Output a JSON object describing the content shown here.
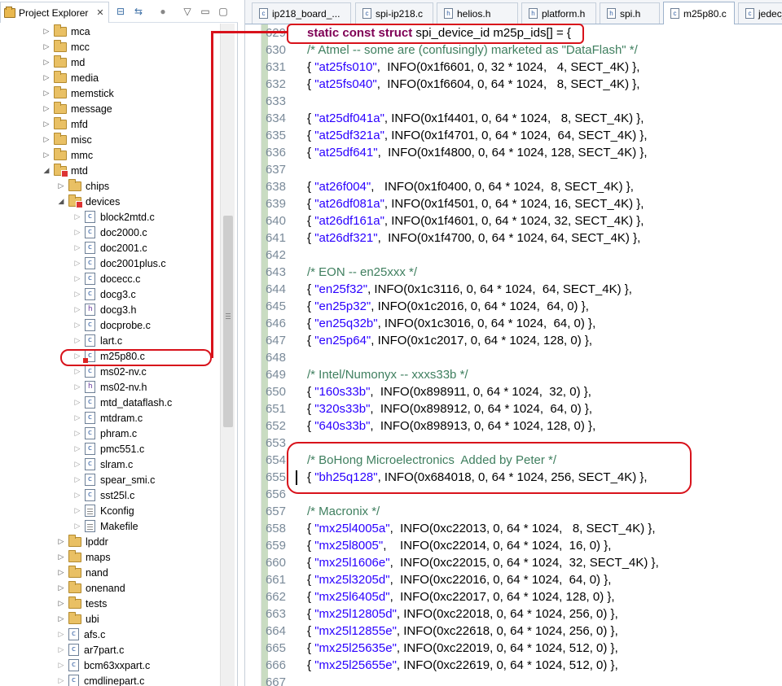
{
  "project_explorer": {
    "tab_label": "Project Explorer",
    "tree": [
      {
        "label": "mca",
        "type": "folder",
        "depth": 0,
        "expanded": false
      },
      {
        "label": "mcc",
        "type": "folder",
        "depth": 0,
        "expanded": false
      },
      {
        "label": "md",
        "type": "folder",
        "depth": 0,
        "expanded": false
      },
      {
        "label": "media",
        "type": "folder",
        "depth": 0,
        "expanded": false
      },
      {
        "label": "memstick",
        "type": "folder",
        "depth": 0,
        "expanded": false
      },
      {
        "label": "message",
        "type": "folder",
        "depth": 0,
        "expanded": false
      },
      {
        "label": "mfd",
        "type": "folder",
        "depth": 0,
        "expanded": false
      },
      {
        "label": "misc",
        "type": "folder",
        "depth": 0,
        "expanded": false
      },
      {
        "label": "mmc",
        "type": "folder",
        "depth": 0,
        "expanded": false
      },
      {
        "label": "mtd",
        "type": "folder-error",
        "depth": 0,
        "expanded": true
      },
      {
        "label": "chips",
        "type": "folder",
        "depth": 1,
        "expanded": false
      },
      {
        "label": "devices",
        "type": "folder-error",
        "depth": 1,
        "expanded": true
      },
      {
        "label": "block2mtd.c",
        "type": "c",
        "depth": 2
      },
      {
        "label": "doc2000.c",
        "type": "c",
        "depth": 2
      },
      {
        "label": "doc2001.c",
        "type": "c",
        "depth": 2
      },
      {
        "label": "doc2001plus.c",
        "type": "c",
        "depth": 2
      },
      {
        "label": "docecc.c",
        "type": "c",
        "depth": 2
      },
      {
        "label": "docg3.c",
        "type": "c",
        "depth": 2
      },
      {
        "label": "docg3.h",
        "type": "h",
        "depth": 2
      },
      {
        "label": "docprobe.c",
        "type": "c",
        "depth": 2
      },
      {
        "label": "lart.c",
        "type": "c",
        "depth": 2
      },
      {
        "label": "m25p80.c",
        "type": "c-error",
        "depth": 2
      },
      {
        "label": "ms02-nv.c",
        "type": "c",
        "depth": 2
      },
      {
        "label": "ms02-nv.h",
        "type": "h",
        "depth": 2
      },
      {
        "label": "mtd_dataflash.c",
        "type": "c",
        "depth": 2
      },
      {
        "label": "mtdram.c",
        "type": "c",
        "depth": 2
      },
      {
        "label": "phram.c",
        "type": "c",
        "depth": 2
      },
      {
        "label": "pmc551.c",
        "type": "c",
        "depth": 2
      },
      {
        "label": "slram.c",
        "type": "c",
        "depth": 2
      },
      {
        "label": "spear_smi.c",
        "type": "c",
        "depth": 2
      },
      {
        "label": "sst25l.c",
        "type": "c",
        "depth": 2
      },
      {
        "label": "Kconfig",
        "type": "plain",
        "depth": 2
      },
      {
        "label": "Makefile",
        "type": "plain",
        "depth": 2
      },
      {
        "label": "lpddr",
        "type": "folder",
        "depth": 1,
        "expanded": false
      },
      {
        "label": "maps",
        "type": "folder",
        "depth": 1,
        "expanded": false
      },
      {
        "label": "nand",
        "type": "folder",
        "depth": 1,
        "expanded": false
      },
      {
        "label": "onenand",
        "type": "folder",
        "depth": 1,
        "expanded": false
      },
      {
        "label": "tests",
        "type": "folder",
        "depth": 1,
        "expanded": false
      },
      {
        "label": "ubi",
        "type": "folder",
        "depth": 1,
        "expanded": false
      },
      {
        "label": "afs.c",
        "type": "c",
        "depth": 1
      },
      {
        "label": "ar7part.c",
        "type": "c",
        "depth": 1
      },
      {
        "label": "bcm63xxpart.c",
        "type": "c",
        "depth": 1
      },
      {
        "label": "cmdlinepart.c",
        "type": "c",
        "depth": 1
      }
    ]
  },
  "editor": {
    "tabs": [
      {
        "label": "ip218_board_...",
        "icon": "c-file-icon",
        "active": false
      },
      {
        "label": "spi-ip218.c",
        "icon": "c-file-icon",
        "active": false
      },
      {
        "label": "helios.h",
        "icon": "h-file-icon",
        "active": false
      },
      {
        "label": "platform.h",
        "icon": "h-file-icon",
        "active": false
      },
      {
        "label": "spi.h",
        "icon": "h-file-icon",
        "active": false
      },
      {
        "label": "m25p80.c",
        "icon": "c-file-icon",
        "active": true
      },
      {
        "label": "jedec_",
        "icon": "c-file-icon",
        "active": false
      }
    ],
    "lines": [
      {
        "n": "629",
        "segs": [
          {
            "t": "static const struct ",
            "c": "kw"
          },
          {
            "t": "spi_device_id m25p_ids[] = {",
            "c": ""
          }
        ]
      },
      {
        "n": "630",
        "segs": [
          {
            "t": "/* Atmel -- some are (confusingly) marketed as \"DataFlash\" */",
            "c": "cm"
          }
        ]
      },
      {
        "n": "631",
        "segs": [
          {
            "t": "{ ",
            "c": ""
          },
          {
            "t": "\"at25fs010\"",
            "c": "st"
          },
          {
            "t": ",  INFO(0x1f6601, 0, 32 * 1024,   4, SECT_4K) },",
            "c": ""
          }
        ]
      },
      {
        "n": "632",
        "segs": [
          {
            "t": "{ ",
            "c": ""
          },
          {
            "t": "\"at25fs040\"",
            "c": "st"
          },
          {
            "t": ",  INFO(0x1f6604, 0, 64 * 1024,   8, SECT_4K) },",
            "c": ""
          }
        ]
      },
      {
        "n": "633",
        "segs": []
      },
      {
        "n": "634",
        "segs": [
          {
            "t": "{ ",
            "c": ""
          },
          {
            "t": "\"at25df041a\"",
            "c": "st"
          },
          {
            "t": ", INFO(0x1f4401, 0, 64 * 1024,   8, SECT_4K) },",
            "c": ""
          }
        ]
      },
      {
        "n": "635",
        "segs": [
          {
            "t": "{ ",
            "c": ""
          },
          {
            "t": "\"at25df321a\"",
            "c": "st"
          },
          {
            "t": ", INFO(0x1f4701, 0, 64 * 1024,  64, SECT_4K) },",
            "c": ""
          }
        ]
      },
      {
        "n": "636",
        "segs": [
          {
            "t": "{ ",
            "c": ""
          },
          {
            "t": "\"at25df641\"",
            "c": "st"
          },
          {
            "t": ",  INFO(0x1f4800, 0, 64 * 1024, 128, SECT_4K) },",
            "c": ""
          }
        ]
      },
      {
        "n": "637",
        "segs": []
      },
      {
        "n": "638",
        "segs": [
          {
            "t": "{ ",
            "c": ""
          },
          {
            "t": "\"at26f004\"",
            "c": "st"
          },
          {
            "t": ",   INFO(0x1f0400, 0, 64 * 1024,  8, SECT_4K) },",
            "c": ""
          }
        ]
      },
      {
        "n": "639",
        "segs": [
          {
            "t": "{ ",
            "c": ""
          },
          {
            "t": "\"at26df081a\"",
            "c": "st"
          },
          {
            "t": ", INFO(0x1f4501, 0, 64 * 1024, 16, SECT_4K) },",
            "c": ""
          }
        ]
      },
      {
        "n": "640",
        "segs": [
          {
            "t": "{ ",
            "c": ""
          },
          {
            "t": "\"at26df161a\"",
            "c": "st"
          },
          {
            "t": ", INFO(0x1f4601, 0, 64 * 1024, 32, SECT_4K) },",
            "c": ""
          }
        ]
      },
      {
        "n": "641",
        "segs": [
          {
            "t": "{ ",
            "c": ""
          },
          {
            "t": "\"at26df321\"",
            "c": "st"
          },
          {
            "t": ",  INFO(0x1f4700, 0, 64 * 1024, 64, SECT_4K) },",
            "c": ""
          }
        ]
      },
      {
        "n": "642",
        "segs": []
      },
      {
        "n": "643",
        "segs": [
          {
            "t": "/* EON -- en25xxx */",
            "c": "cm"
          }
        ]
      },
      {
        "n": "644",
        "segs": [
          {
            "t": "{ ",
            "c": ""
          },
          {
            "t": "\"en25f32\"",
            "c": "st"
          },
          {
            "t": ", INFO(0x1c3116, 0, 64 * 1024,  64, SECT_4K) },",
            "c": ""
          }
        ]
      },
      {
        "n": "645",
        "segs": [
          {
            "t": "{ ",
            "c": ""
          },
          {
            "t": "\"en25p32\"",
            "c": "st"
          },
          {
            "t": ", INFO(0x1c2016, 0, 64 * 1024,  64, 0) },",
            "c": ""
          }
        ]
      },
      {
        "n": "646",
        "segs": [
          {
            "t": "{ ",
            "c": ""
          },
          {
            "t": "\"en25q32b\"",
            "c": "st"
          },
          {
            "t": ", INFO(0x1c3016, 0, 64 * 1024,  64, 0) },",
            "c": ""
          }
        ]
      },
      {
        "n": "647",
        "segs": [
          {
            "t": "{ ",
            "c": ""
          },
          {
            "t": "\"en25p64\"",
            "c": "st"
          },
          {
            "t": ", INFO(0x1c2017, 0, 64 * 1024, 128, 0) },",
            "c": ""
          }
        ]
      },
      {
        "n": "648",
        "segs": []
      },
      {
        "n": "649",
        "segs": [
          {
            "t": "/* Intel/Numonyx -- xxxs33b */",
            "c": "cm"
          }
        ]
      },
      {
        "n": "650",
        "segs": [
          {
            "t": "{ ",
            "c": ""
          },
          {
            "t": "\"160s33b\"",
            "c": "st"
          },
          {
            "t": ",  INFO(0x898911, 0, 64 * 1024,  32, 0) },",
            "c": ""
          }
        ]
      },
      {
        "n": "651",
        "segs": [
          {
            "t": "{ ",
            "c": ""
          },
          {
            "t": "\"320s33b\"",
            "c": "st"
          },
          {
            "t": ",  INFO(0x898912, 0, 64 * 1024,  64, 0) },",
            "c": ""
          }
        ]
      },
      {
        "n": "652",
        "segs": [
          {
            "t": "{ ",
            "c": ""
          },
          {
            "t": "\"640s33b\"",
            "c": "st"
          },
          {
            "t": ",  INFO(0x898913, 0, 64 * 1024, 128, 0) },",
            "c": ""
          }
        ]
      },
      {
        "n": "653",
        "segs": []
      },
      {
        "n": "654",
        "segs": [
          {
            "t": "/* BoHong Microelectronics  Added by Peter */",
            "c": "cm"
          }
        ]
      },
      {
        "n": "655",
        "segs": [
          {
            "t": "{ ",
            "c": ""
          },
          {
            "t": "\"bh25q128\"",
            "c": "st"
          },
          {
            "t": ", INFO(0x684018, 0, 64 * 1024, 256, SECT_4K) },",
            "c": ""
          }
        ]
      },
      {
        "n": "656",
        "segs": []
      },
      {
        "n": "657",
        "segs": [
          {
            "t": "/* Macronix */",
            "c": "cm"
          }
        ]
      },
      {
        "n": "658",
        "segs": [
          {
            "t": "{ ",
            "c": ""
          },
          {
            "t": "\"mx25l4005a\"",
            "c": "st"
          },
          {
            "t": ",  INFO(0xc22013, 0, 64 * 1024,   8, SECT_4K) },",
            "c": ""
          }
        ]
      },
      {
        "n": "659",
        "segs": [
          {
            "t": "{ ",
            "c": ""
          },
          {
            "t": "\"mx25l8005\"",
            "c": "st"
          },
          {
            "t": ",    INFO(0xc22014, 0, 64 * 1024,  16, 0) },",
            "c": ""
          }
        ]
      },
      {
        "n": "660",
        "segs": [
          {
            "t": "{ ",
            "c": ""
          },
          {
            "t": "\"mx25l1606e\"",
            "c": "st"
          },
          {
            "t": ",  INFO(0xc22015, 0, 64 * 1024,  32, SECT_4K) },",
            "c": ""
          }
        ]
      },
      {
        "n": "661",
        "segs": [
          {
            "t": "{ ",
            "c": ""
          },
          {
            "t": "\"mx25l3205d\"",
            "c": "st"
          },
          {
            "t": ",  INFO(0xc22016, 0, 64 * 1024,  64, 0) },",
            "c": ""
          }
        ]
      },
      {
        "n": "662",
        "segs": [
          {
            "t": "{ ",
            "c": ""
          },
          {
            "t": "\"mx25l6405d\"",
            "c": "st"
          },
          {
            "t": ",  INFO(0xc22017, 0, 64 * 1024, 128, 0) },",
            "c": ""
          }
        ]
      },
      {
        "n": "663",
        "segs": [
          {
            "t": "{ ",
            "c": ""
          },
          {
            "t": "\"mx25l12805d\"",
            "c": "st"
          },
          {
            "t": ", INFO(0xc22018, 0, 64 * 1024, 256, 0) },",
            "c": ""
          }
        ]
      },
      {
        "n": "664",
        "segs": [
          {
            "t": "{ ",
            "c": ""
          },
          {
            "t": "\"mx25l12855e\"",
            "c": "st"
          },
          {
            "t": ", INFO(0xc22618, 0, 64 * 1024, 256, 0) },",
            "c": ""
          }
        ]
      },
      {
        "n": "665",
        "segs": [
          {
            "t": "{ ",
            "c": ""
          },
          {
            "t": "\"mx25l25635e\"",
            "c": "st"
          },
          {
            "t": ", INFO(0xc22019, 0, 64 * 1024, 512, 0) },",
            "c": ""
          }
        ]
      },
      {
        "n": "666",
        "segs": [
          {
            "t": "{ ",
            "c": ""
          },
          {
            "t": "\"mx25l25655e\"",
            "c": "st"
          },
          {
            "t": ", INFO(0xc22619, 0, 64 * 1024, 512, 0) },",
            "c": ""
          }
        ]
      },
      {
        "n": "667",
        "segs": []
      }
    ]
  },
  "colors": {
    "annotation_red": "#d8121b",
    "keyword": "#7f0055",
    "comment": "#3f7f5f",
    "string": "#2a00ff"
  }
}
